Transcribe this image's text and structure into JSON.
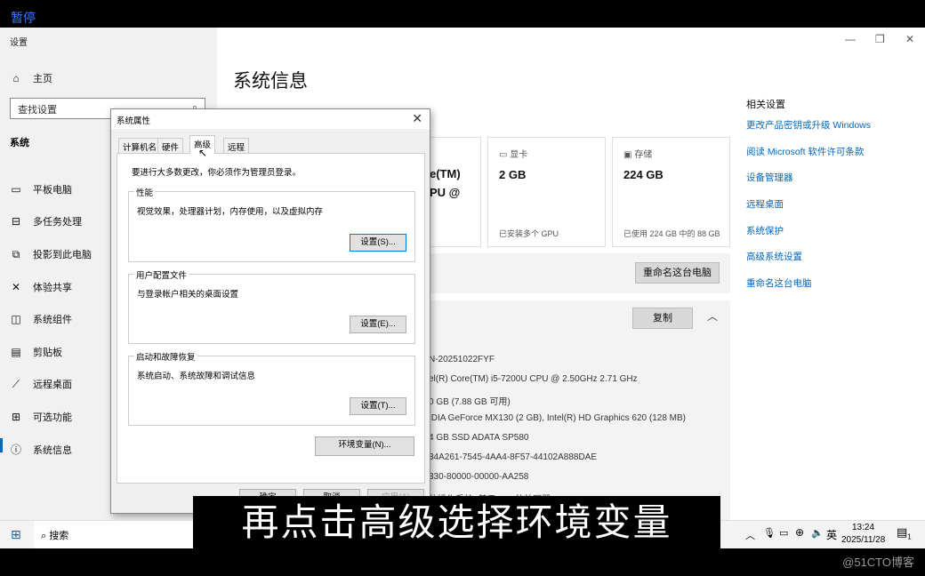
{
  "overlay": {
    "pause": "暂停",
    "subtitle": "再点击高级选择环境变量",
    "watermark": "@51CTO博客"
  },
  "settings": {
    "app_title": "设置",
    "home": "主页",
    "search_placeholder": "查找设置",
    "section": "系统",
    "nav": [
      "平板电脑",
      "多任务处理",
      "投影到此电脑",
      "体验共享",
      "系统组件",
      "剪贴板",
      "远程桌面",
      "可选功能",
      "系统信息"
    ],
    "page_title": "系统信息",
    "cards": [
      {
        "partial_value": "e(TM)\nPU @"
      },
      {
        "label": "显卡",
        "value": "2 GB",
        "sub": "已安装多个 GPU"
      },
      {
        "label": "存储",
        "value": "224 GB",
        "sub": "已使用 224 GB 中的 88 GB"
      }
    ],
    "rename_button": "重命名这台电脑",
    "copy_button": "复制",
    "specs": [
      "N-20251022FYF",
      "el(R) Core(TM) i5-7200U CPU @ 2.50GHz   2.71 GHz",
      "0 GB (7.88 GB 可用)",
      "IDIA GeForce MX130 (2 GB), Intel(R) HD Graphics 620 (128 MB)",
      "4 GB SSD ADATA SP580",
      "34A261-7545-4AA4-8F57-44102A888DAE",
      "330-80000-00000-AA258",
      "位操作系统, 基于 x64 的处理器"
    ],
    "related": {
      "heading": "相关设置",
      "links": [
        "更改产品密钥或升级 Windows",
        "阅读 Microsoft 软件许可条款",
        "设备管理器",
        "远程桌面",
        "系统保护",
        "高级系统设置",
        "重命名这台电脑"
      ]
    }
  },
  "dialog": {
    "title": "系统属性",
    "tabs": [
      "计算机名",
      "硬件",
      "高级",
      "远程"
    ],
    "active_tab": 2,
    "admin_note": "要进行大多数更改，你必须作为管理员登录。",
    "groups": [
      {
        "label": "性能",
        "desc": "视觉效果，处理器计划，内存使用，以及虚拟内存",
        "button": "设置(S)..."
      },
      {
        "label": "用户配置文件",
        "desc": "与登录帐户相关的桌面设置",
        "button": "设置(E)..."
      },
      {
        "label": "启动和故障恢复",
        "desc": "系统启动、系统故障和调试信息",
        "button": "设置(T)..."
      }
    ],
    "env_button": "环境变量(N)...",
    "ok": "确定",
    "cancel": "取消",
    "apply": "应用(A)"
  },
  "taskbar": {
    "search": "搜索",
    "ime": "英",
    "time": "13:24",
    "date": "2025/11/28",
    "notif_count": "1"
  }
}
